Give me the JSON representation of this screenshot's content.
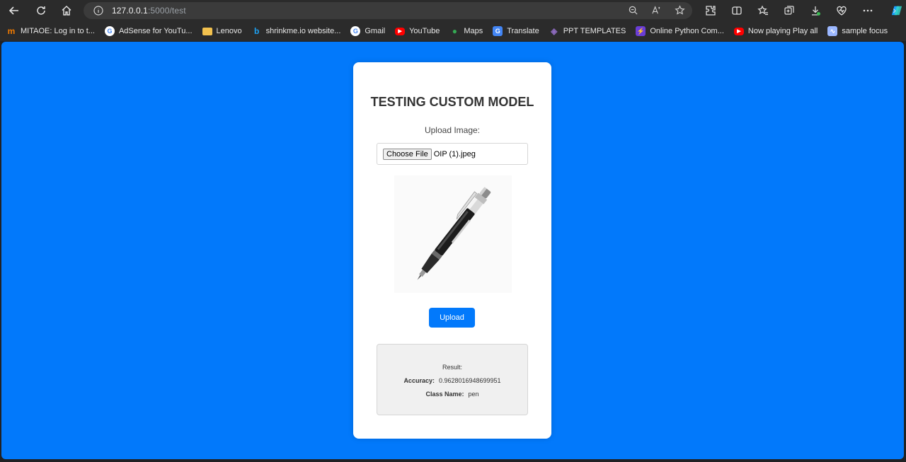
{
  "browser": {
    "url_host": "127.0.0.1",
    "url_path": ":5000/test",
    "bookmarks": [
      {
        "label": "MITAOE: Log in to t...",
        "icon": "mitaoe-icon",
        "color": "#f57c00",
        "glyph": "m"
      },
      {
        "label": "AdSense for YouTu...",
        "icon": "google-icon",
        "color": "#ffffff",
        "glyph": "G"
      },
      {
        "label": "Lenovo",
        "icon": "folder-icon",
        "color": "#f2c14e",
        "glyph": ""
      },
      {
        "label": "shrinkme.io website...",
        "icon": "bing-icon",
        "color": "#1ea1f2",
        "glyph": "b"
      },
      {
        "label": "Gmail",
        "icon": "google-icon",
        "color": "#ffffff",
        "glyph": "G"
      },
      {
        "label": "YouTube",
        "icon": "youtube-icon",
        "color": "#ff0000",
        "glyph": "▶"
      },
      {
        "label": "Maps",
        "icon": "maps-icon",
        "color": "#34a853",
        "glyph": "●"
      },
      {
        "label": "Translate",
        "icon": "translate-icon",
        "color": "#4285f4",
        "glyph": "G"
      },
      {
        "label": "PPT TEMPLATES",
        "icon": "ppt-icon",
        "color": "#8e6bbf",
        "glyph": "◈"
      },
      {
        "label": "Online Python Com...",
        "icon": "python-icon",
        "color": "#6a3dd6",
        "glyph": "⚡"
      },
      {
        "label": "Now playing Play all",
        "icon": "youtube-icon",
        "color": "#ff0000",
        "glyph": "▶"
      },
      {
        "label": "sample focus",
        "icon": "sample-icon",
        "color": "#9bb7ff",
        "glyph": "∿"
      }
    ]
  },
  "card": {
    "title": "TESTING CUSTOM MODEL",
    "upload_label": "Upload Image:",
    "file_button": "Choose File",
    "file_name": "OIP (1).jpeg",
    "upload_button": "Upload",
    "result_heading": "Result:",
    "accuracy_label": "Accuracy:",
    "accuracy_value": "0.9628016948699951",
    "class_label": "Class Name:",
    "class_value": "pen"
  },
  "colors": {
    "page_background": "#0279fb",
    "card_background": "#ffffff",
    "button_background": "#0279fb",
    "result_background": "#f0f0f0"
  }
}
